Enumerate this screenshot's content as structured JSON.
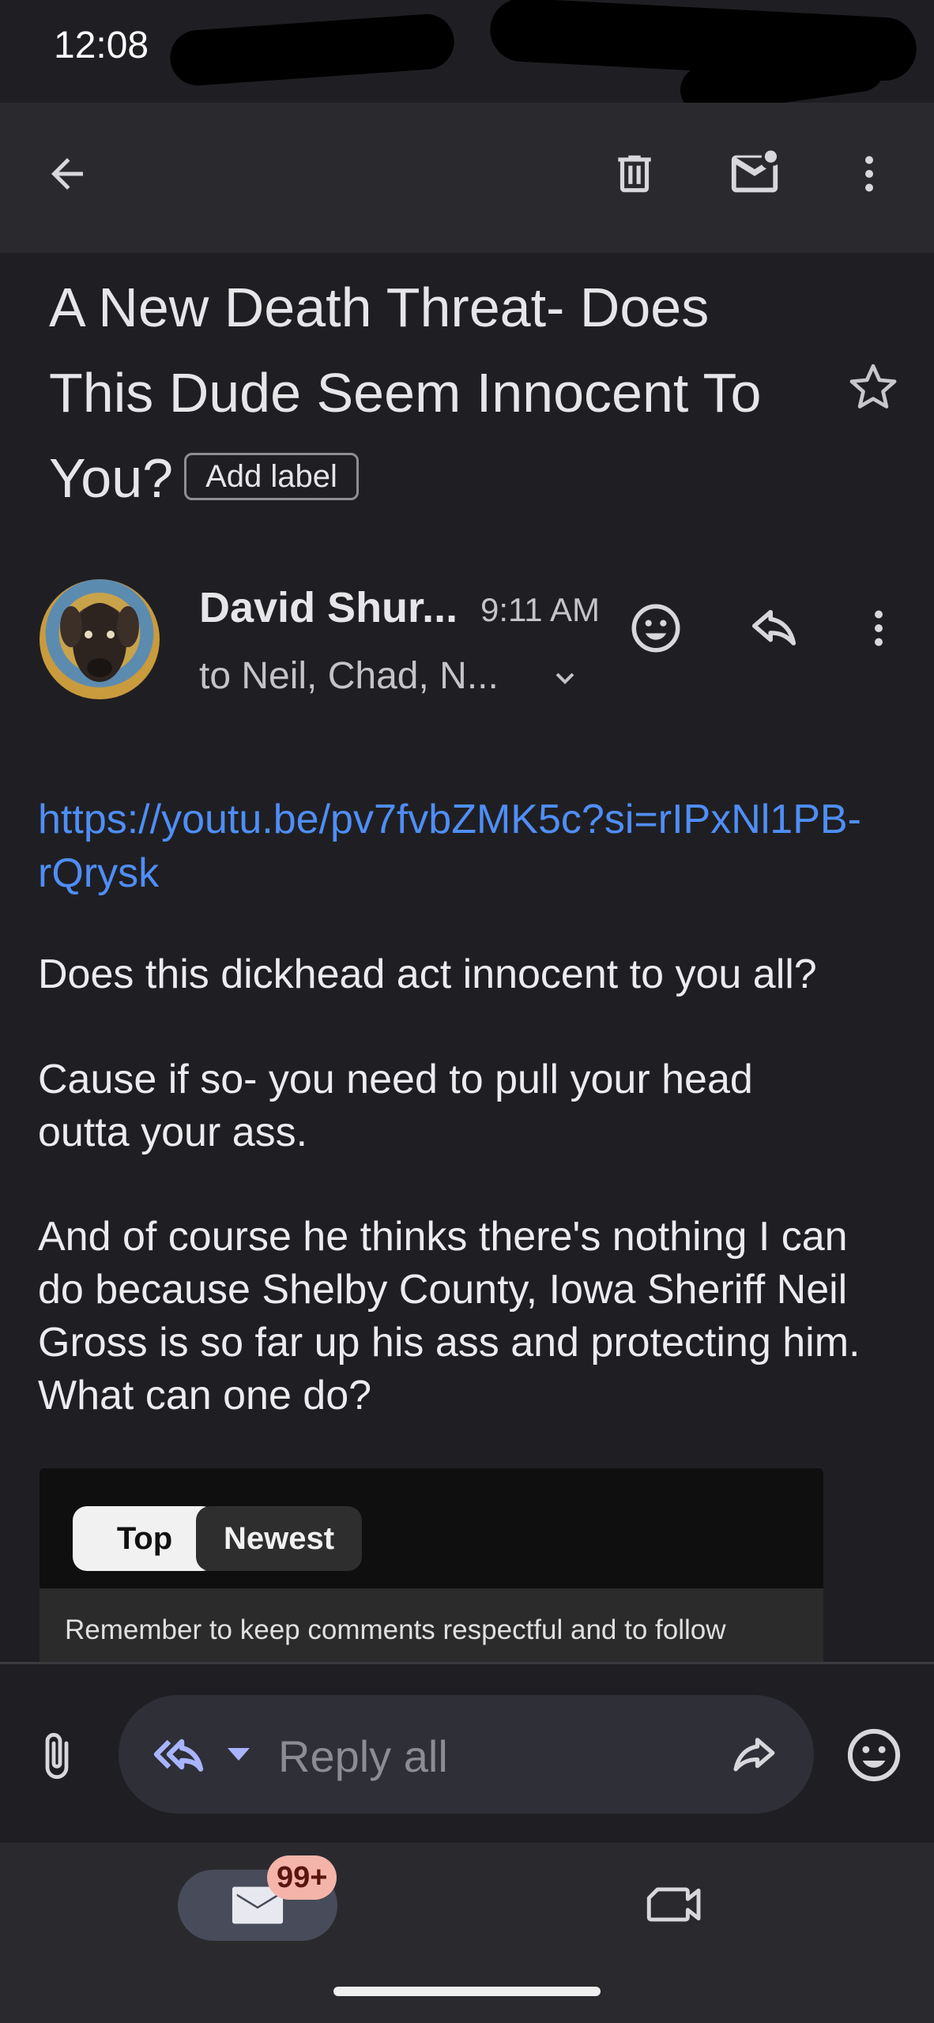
{
  "status_bar": {
    "time": "12:08"
  },
  "toolbar": {
    "back_icon": "arrow-left-icon",
    "delete_icon": "trash-icon",
    "mark_unread_icon": "mail-unread-icon",
    "more_icon": "more-vertical-icon"
  },
  "email": {
    "subject": "A New Death Threat- Does This Dude Seem Innocent To You?",
    "add_label": "Add label",
    "sender": {
      "name": "David Shur...",
      "time": "9:11 AM",
      "recipients": "to Neil, Chad, N..."
    },
    "body": {
      "link": "https://youtu.be/pv7fvbZMK5c?si=rIPxNl1PB-rQrysk",
      "paragraphs": [
        "Does this dickhead act innocent to you all?",
        "Cause if so- you need to pull your head outta your ass.",
        "And of course he thinks there's nothing I can do because Shelby County, Iowa Sheriff Neil Gross is so far up his ass and protecting him. What can one do?"
      ]
    },
    "embed": {
      "tabs": [
        "Top",
        "Newest"
      ],
      "notice": "Remember to keep comments respectful and to follow"
    }
  },
  "compose": {
    "placeholder": "Reply all"
  },
  "bottom_nav": {
    "mail_badge": "99+"
  },
  "colors": {
    "background": "#1f1f23",
    "toolbar": "#2a2a2e",
    "link": "#4f8ef7",
    "reply_accent": "#a8b4ff",
    "badge": "#f4b4aa"
  }
}
